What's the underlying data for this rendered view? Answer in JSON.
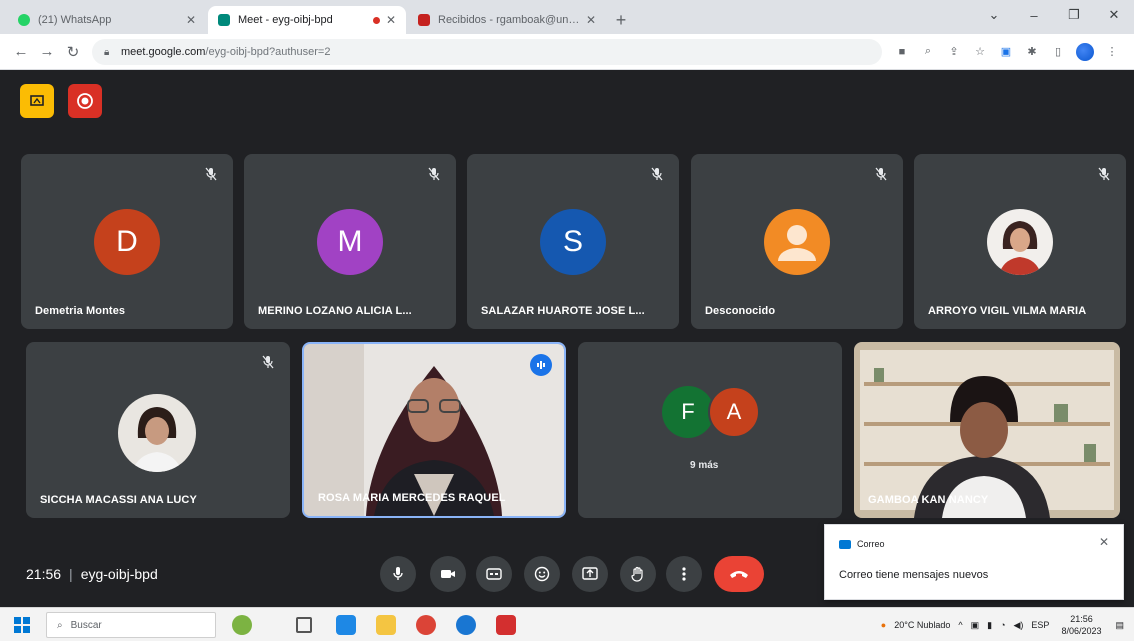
{
  "browser": {
    "tabs": [
      {
        "title": "(21) WhatsApp",
        "favicon_color": "#25d366"
      },
      {
        "title": "Meet - eyg-oibj-bpd",
        "favicon_color": "#00897b"
      },
      {
        "title": "Recibidos - rgamboak@unac.e",
        "favicon_color": "#c5221f"
      }
    ],
    "url_main": "meet.google.com",
    "url_rest": "/eyg-oibj-bpd?authuser=2"
  },
  "meet": {
    "time": "21:56",
    "code": "eyg-oibj-bpd",
    "more_count": "9 más",
    "participants": [
      {
        "name": "Demetria Montes",
        "initial": "D",
        "color": "#c5411c"
      },
      {
        "name": "MERINO LOZANO ALICIA L...",
        "initial": "M",
        "color": "#a142c4"
      },
      {
        "name": "SALAZAR HUAROTE JOSE L...",
        "initial": "S",
        "color": "#1558b0"
      },
      {
        "name": "Desconocido"
      },
      {
        "name": "ARROYO VIGIL VILMA MARIA"
      },
      {
        "name": "SICCHA MACASSI ANA LUCY"
      },
      {
        "name": "ROSA MARIA MERCEDES RAQUEL"
      },
      {
        "name": "GAMBOA KAN NANCY"
      }
    ],
    "more_initials": [
      {
        "initial": "F",
        "color": "#137333"
      },
      {
        "initial": "A",
        "color": "#c5411c"
      }
    ]
  },
  "notification": {
    "app": "Correo",
    "message": "Correo tiene mensajes nuevos"
  },
  "taskbar": {
    "search_placeholder": "Buscar",
    "weather": "20°C Nublado",
    "language": "ESP",
    "time": "21:56",
    "date": "8/06/2023"
  },
  "colors": {
    "meet_background": "#202124",
    "tile_background": "#3c4043",
    "hangup": "#ea4335",
    "speaking_blue": "#1a73e8"
  }
}
